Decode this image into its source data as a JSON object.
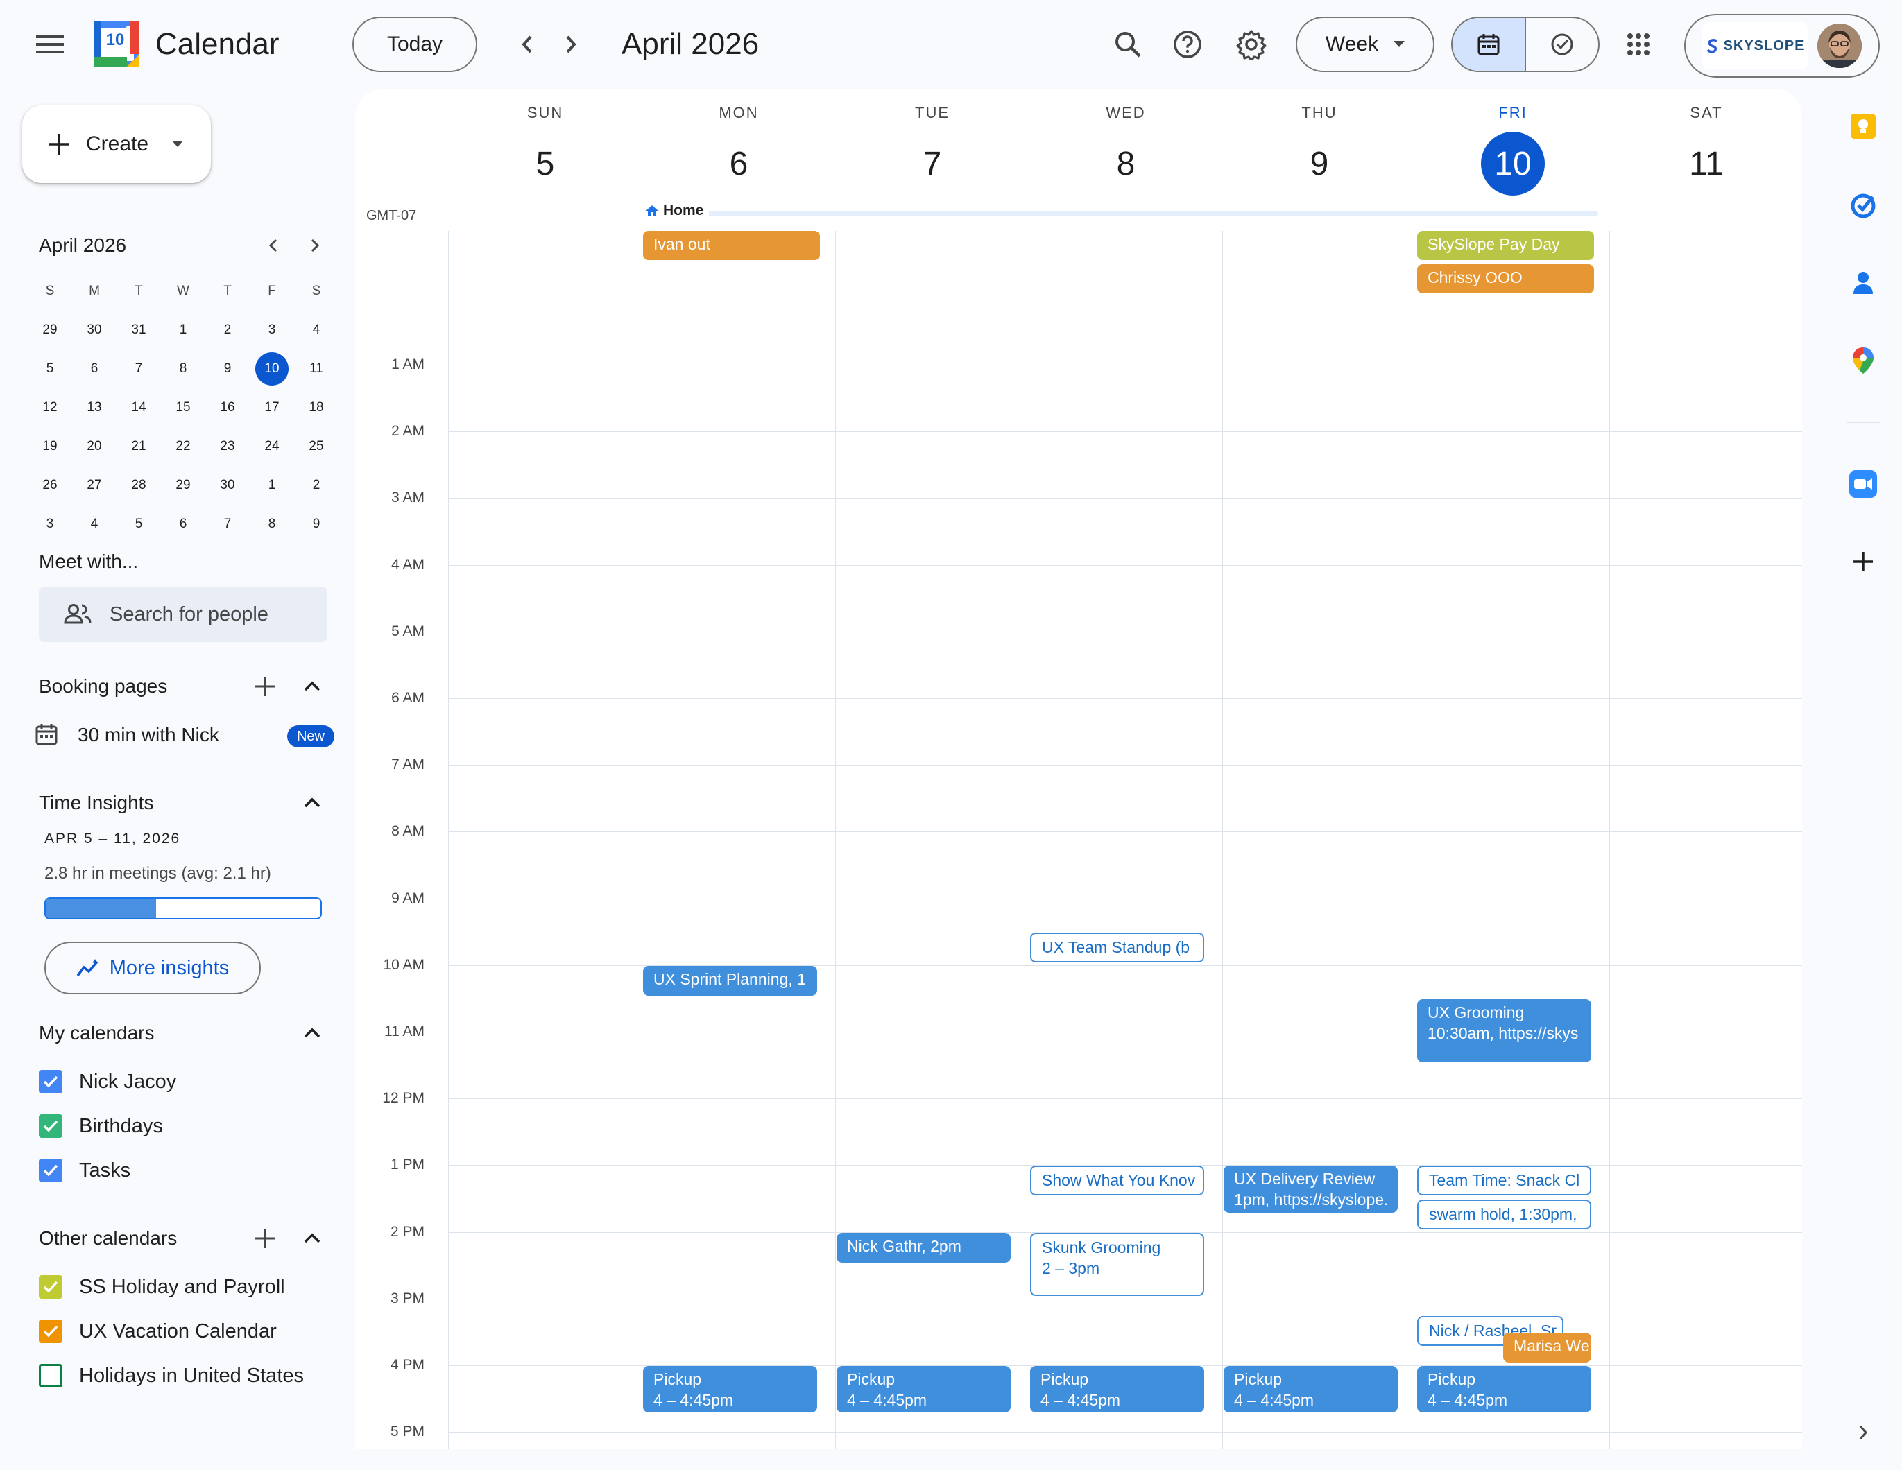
{
  "header": {
    "app_title": "Calendar",
    "logo_day": "10",
    "today_label": "Today",
    "month_title": "April 2026",
    "view_label": "Week",
    "org_name": "SKYSLOPE"
  },
  "sidebar": {
    "create_label": "Create",
    "mini_month_title": "April 2026",
    "mini_weekdays": [
      "S",
      "M",
      "T",
      "W",
      "T",
      "F",
      "S"
    ],
    "mini_days": [
      "29",
      "30",
      "31",
      "1",
      "2",
      "3",
      "4",
      "5",
      "6",
      "7",
      "8",
      "9",
      "10",
      "11",
      "12",
      "13",
      "14",
      "15",
      "16",
      "17",
      "18",
      "19",
      "20",
      "21",
      "22",
      "23",
      "24",
      "25",
      "26",
      "27",
      "28",
      "29",
      "30",
      "1",
      "2",
      "3",
      "4",
      "5",
      "6",
      "7",
      "8",
      "9"
    ],
    "mini_selected_index": 12,
    "meet_with_title": "Meet with...",
    "search_people_placeholder": "Search for people",
    "booking_title": "Booking pages",
    "booking_item": "30 min with Nick",
    "booking_badge": "New",
    "insights_title": "Time Insights",
    "insights_range": "APR 5 – 11, 2026",
    "insights_meetings": "2.8 hr in meetings (avg: 2.1 hr)",
    "insights_fraction": 0.41,
    "more_insights_label": "More insights",
    "my_calendars_title": "My calendars",
    "my_calendars": [
      {
        "label": "Nick Jacoy",
        "color": "#4285f4",
        "checked": true
      },
      {
        "label": "Birthdays",
        "color": "#33b679",
        "checked": true
      },
      {
        "label": "Tasks",
        "color": "#4285f4",
        "checked": true
      }
    ],
    "other_calendars_title": "Other calendars",
    "other_calendars": [
      {
        "label": "SS Holiday and Payroll",
        "color": "#c0ca33",
        "checked": true
      },
      {
        "label": "UX Vacation Calendar",
        "color": "#f09300",
        "checked": true
      },
      {
        "label": "Holidays in United States",
        "color": "#0b8043",
        "checked": false
      }
    ]
  },
  "week": {
    "timezone": "GMT-07",
    "days": [
      {
        "name": "SUN",
        "num": "5",
        "today": false
      },
      {
        "name": "MON",
        "num": "6",
        "today": false
      },
      {
        "name": "TUE",
        "num": "7",
        "today": false
      },
      {
        "name": "WED",
        "num": "8",
        "today": false
      },
      {
        "name": "THU",
        "num": "9",
        "today": false
      },
      {
        "name": "FRI",
        "num": "10",
        "today": true
      },
      {
        "name": "SAT",
        "num": "11",
        "today": false
      }
    ],
    "hours": [
      "1 AM",
      "2 AM",
      "3 AM",
      "4 AM",
      "5 AM",
      "6 AM",
      "7 AM",
      "8 AM",
      "9 AM",
      "10 AM",
      "11 AM",
      "12 PM",
      "1 PM",
      "2 PM",
      "3 PM",
      "4 PM",
      "5 PM"
    ],
    "working_location": "Home",
    "allday_events": [
      {
        "day": 1,
        "row": 0,
        "title": "Ivan out",
        "style": "orange"
      },
      {
        "day": 5,
        "row": 0,
        "title": "SkySlope Pay Day",
        "style": "lime"
      },
      {
        "day": 5,
        "row": 1,
        "title": "Chrissy OOO",
        "style": "orange"
      }
    ],
    "events": [
      {
        "day": 3,
        "start": 9.5,
        "end": 10.0,
        "title": "UX Team Standup (b",
        "style": "outline"
      },
      {
        "day": 1,
        "start": 10.0,
        "end": 10.5,
        "title": "UX Sprint Planning, 1",
        "style": "blue"
      },
      {
        "day": 5,
        "start": 10.5,
        "end": 11.5,
        "title": "UX Grooming",
        "sub": "10:30am, https://skys",
        "style": "blue"
      },
      {
        "day": 3,
        "start": 13.0,
        "end": 13.5,
        "title": "Show What You Knov",
        "style": "outline"
      },
      {
        "day": 4,
        "start": 13.0,
        "end": 13.75,
        "title": "UX Delivery Review",
        "sub": "1pm, https://skyslope.",
        "style": "blue"
      },
      {
        "day": 5,
        "start": 13.0,
        "end": 13.5,
        "title": "Team Time: Snack Cl",
        "style": "outline"
      },
      {
        "day": 5,
        "start": 13.5,
        "end": 14.0,
        "title": "swarm hold, 1:30pm,",
        "style": "outline"
      },
      {
        "day": 2,
        "start": 14.0,
        "end": 14.5,
        "title": "Nick Gathr, 2pm",
        "style": "blue"
      },
      {
        "day": 3,
        "start": 14.0,
        "end": 15.0,
        "title": "Skunk Grooming",
        "sub": "2 – 3pm",
        "style": "outline"
      },
      {
        "day": 5,
        "start": 15.25,
        "end": 15.75,
        "title": "Nick / Rasheel, Sr",
        "style": "outline",
        "narrow": true
      },
      {
        "day": 5,
        "start": 15.5,
        "end": 16.0,
        "title": "Marisa We",
        "style": "orange",
        "offset": true
      },
      {
        "day": 1,
        "start": 16.0,
        "end": 16.75,
        "title": "Pickup",
        "sub": "4 – 4:45pm",
        "style": "blue"
      },
      {
        "day": 2,
        "start": 16.0,
        "end": 16.75,
        "title": "Pickup",
        "sub": "4 – 4:45pm",
        "style": "blue"
      },
      {
        "day": 3,
        "start": 16.0,
        "end": 16.75,
        "title": "Pickup",
        "sub": "4 – 4:45pm",
        "style": "blue"
      },
      {
        "day": 4,
        "start": 16.0,
        "end": 16.75,
        "title": "Pickup",
        "sub": "4 – 4:45pm",
        "style": "blue"
      },
      {
        "day": 5,
        "start": 16.0,
        "end": 16.75,
        "title": "Pickup",
        "sub": "4 – 4:45pm",
        "style": "blue"
      }
    ]
  }
}
